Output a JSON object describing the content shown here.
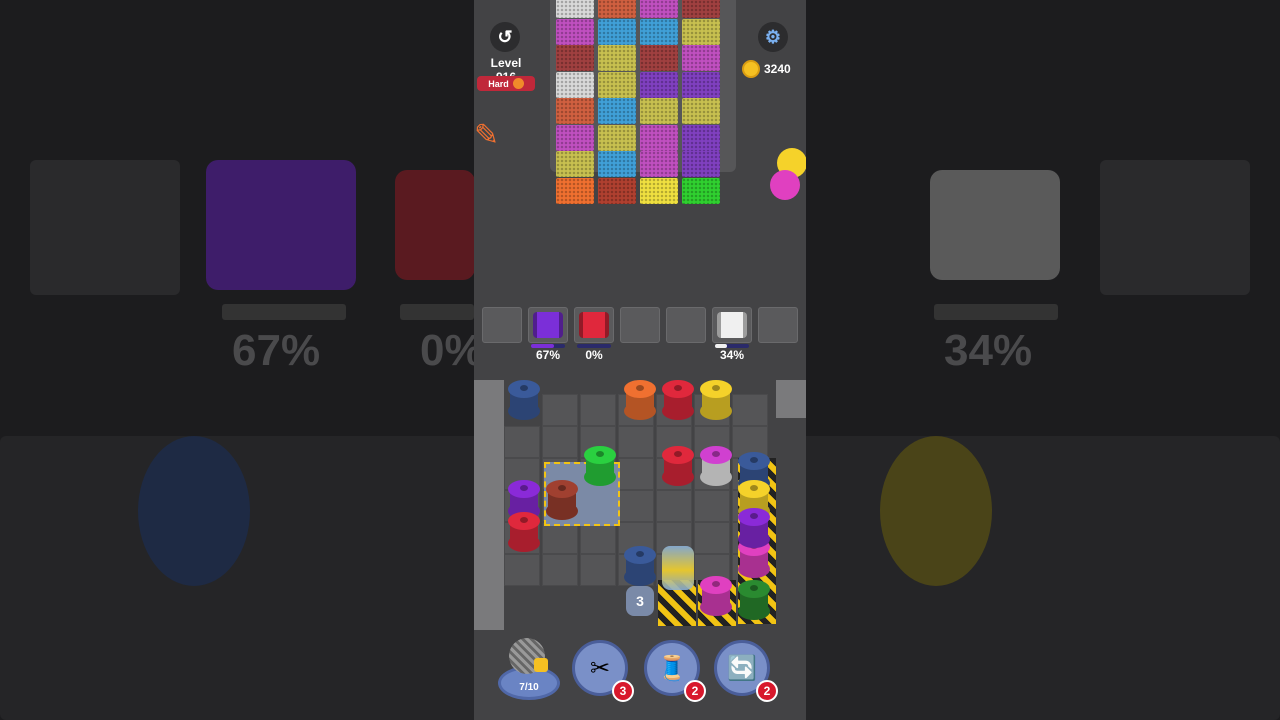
{
  "header": {
    "undo_icon": "undo-icon",
    "level_label": "Level 916",
    "difficulty_label": "Hard",
    "settings_icon": "gear-icon",
    "coin_count": "3240"
  },
  "conveyor": {
    "columns": [
      [
        "#d9d9d9",
        "#c050c0",
        "#a04040",
        "#d9d9d9",
        "#d06040",
        "#c050c0",
        "#c8c050",
        "#f07030"
      ],
      [
        "#d06040",
        "#40a0d8",
        "#c8c050",
        "#c8c050",
        "#40a0d8",
        "#c8c050",
        "#40a0d8",
        "#b04030"
      ],
      [
        "#c050c0",
        "#40a0d8",
        "#a04040",
        "#8040c0",
        "#c8c050",
        "#c050c0",
        "#c050c0",
        "#f0e040"
      ],
      [
        "#a04040",
        "#c8c050",
        "#c050c0",
        "#8040c0",
        "#c8c050",
        "#8040c0",
        "#8040c0",
        "#30d030"
      ]
    ]
  },
  "slots": [
    {
      "color": null
    },
    {
      "color": "#7b2fd8",
      "percent": "67%",
      "progress": 0.67
    },
    {
      "color": "#e0283c",
      "percent": "0%",
      "progress": 0
    },
    {
      "color": null
    },
    {
      "color": null
    },
    {
      "color": "#f0f0f0",
      "percent": "34%",
      "progress": 0.34
    },
    {
      "color": null
    }
  ],
  "board": {
    "spools": [
      {
        "color": "#3a5a9a"
      },
      {
        "color": "#f07030"
      },
      {
        "color": "#e0283c"
      },
      {
        "color": "#f5d22a"
      },
      {
        "color": "#2ad040"
      },
      {
        "color": "#e0283c"
      },
      {
        "color": "#f0f0f0",
        "top": "#d040d0"
      },
      {
        "color": "#8a2ad8"
      },
      {
        "color": "#e0283c"
      },
      {
        "color": "#a04030"
      },
      {
        "color": "#3a5a9a"
      },
      {
        "color": "#f5d22a"
      },
      {
        "color": "#e040c0"
      },
      {
        "color": "#3a5a9a"
      },
      {
        "color": "#8a2ad8"
      },
      {
        "color": "#e040c0"
      },
      {
        "color": "#2a8a30"
      }
    ],
    "hidden_count": "3"
  },
  "tools": {
    "yarn_progress": "7/10",
    "scissors_count": "3",
    "spool_count": "2",
    "magnet_count": "2"
  }
}
